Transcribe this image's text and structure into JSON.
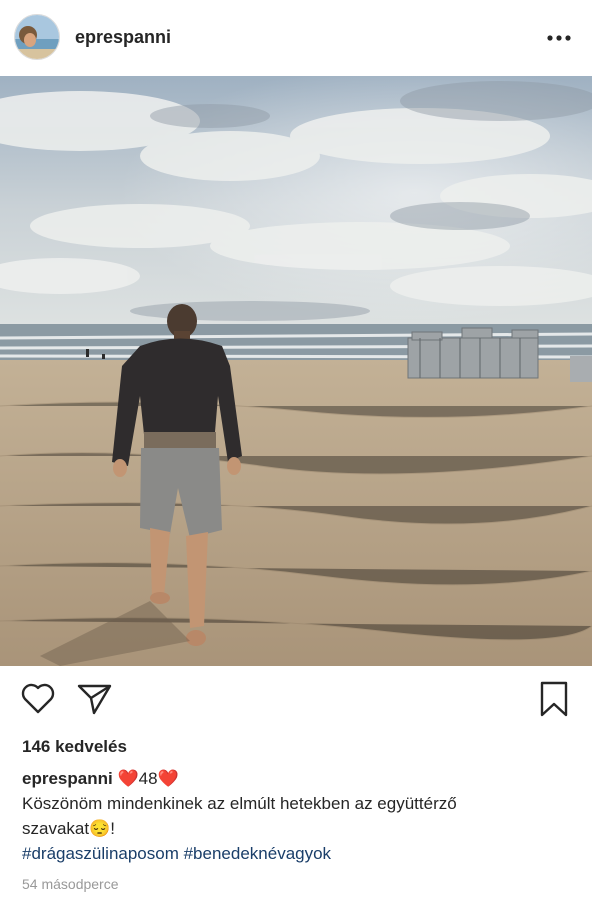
{
  "post": {
    "username": "eprespanni",
    "likes_text": "146 kedvelés",
    "caption": {
      "username": "eprespanni",
      "heart_left": "❤️",
      "number": "48",
      "heart_right": "❤️",
      "line1": "Köszönöm mindenkinek az elmúlt hetekben az együttérző",
      "line2": "szavakat",
      "emoji": "😔",
      "line2_end": "!",
      "hashtags": "#drágaszülinaposom #benedeknévagyok"
    },
    "timestamp": "54 másodperce"
  },
  "icons": {
    "more": "more-horizontal-icon",
    "like": "heart-outline-icon",
    "share": "paper-plane-icon",
    "save": "bookmark-icon"
  },
  "colors": {
    "text": "#262626",
    "heart": "#e0243b",
    "hashtag": "#1a3e69",
    "muted": "#999999"
  }
}
